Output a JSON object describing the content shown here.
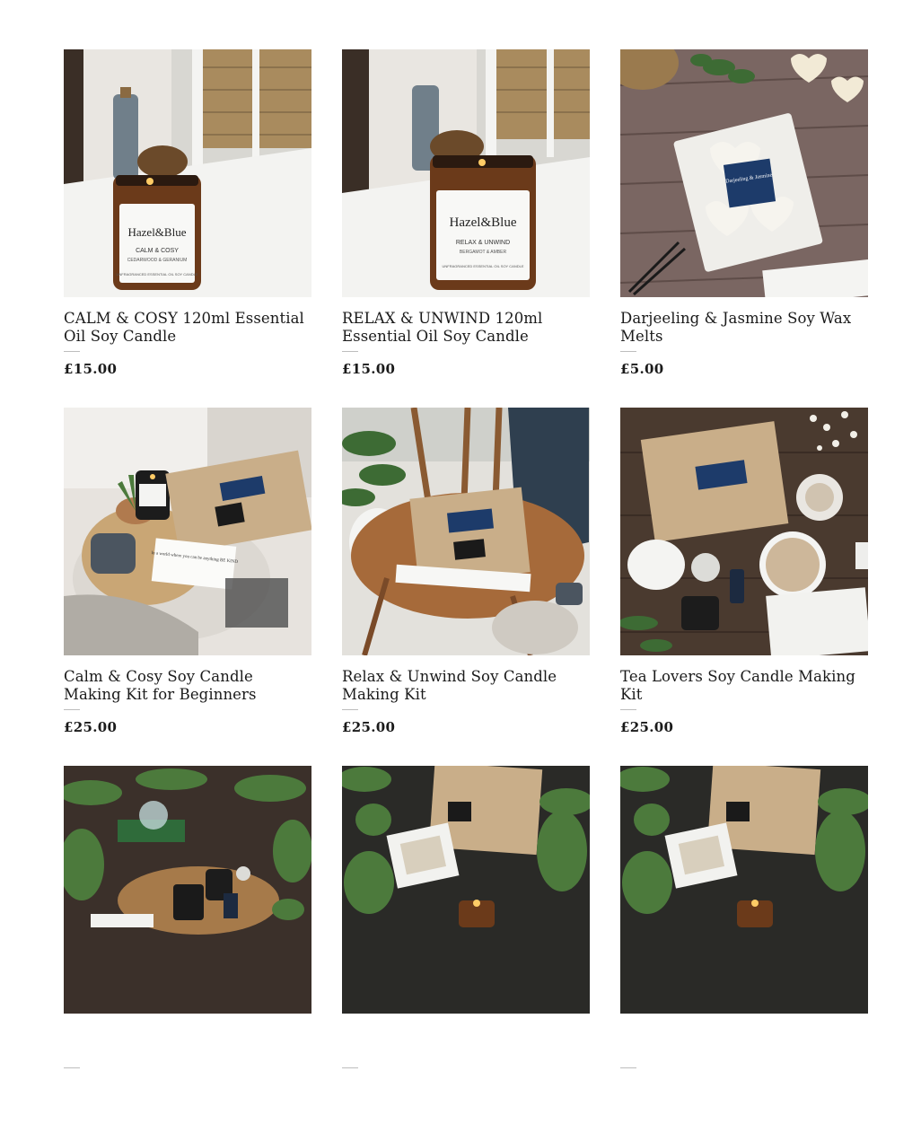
{
  "products": [
    {
      "title": "CALM & COSY 120ml Essential Oil Soy Candle",
      "price": "£15.00"
    },
    {
      "title": "RELAX & UNWIND 120ml Essential Oil Soy Candle",
      "price": "£15.00"
    },
    {
      "title": "Darjeeling & Jasmine Soy Wax Melts",
      "price": "£5.00"
    },
    {
      "title": "Calm & Cosy Soy Candle Making Kit for Beginners",
      "price": "£25.00"
    },
    {
      "title": "Relax & Unwind Soy Candle Making Kit",
      "price": "£25.00"
    },
    {
      "title": "Tea Lovers Soy Candle Making Kit",
      "price": "£25.00"
    },
    {
      "title": "",
      "price": ""
    },
    {
      "title": "",
      "price": ""
    },
    {
      "title": "",
      "price": ""
    }
  ],
  "labels": {
    "brand": "Hazel&Blue",
    "candle1_scent": "CALM & COSY",
    "candle1_notes": "CEDARWOOD & GERANIUM",
    "candle2_scent": "RELAX & UNWIND",
    "candle2_notes": "BERGAMOT & AMBER",
    "candle_footer": "UNFRAGRANCED ESSENTIAL OIL SOY CANDLE",
    "melts_label": "Darjeeling & Jasmine",
    "card_text": "In a world where you can be anything BE KIND"
  },
  "colors": {
    "amber": "#6b3a1a",
    "navy": "#1d3b6a",
    "kraft": "#c9ae89",
    "wood_dark": "#4a3a2f",
    "plant": "#3d6b34"
  }
}
